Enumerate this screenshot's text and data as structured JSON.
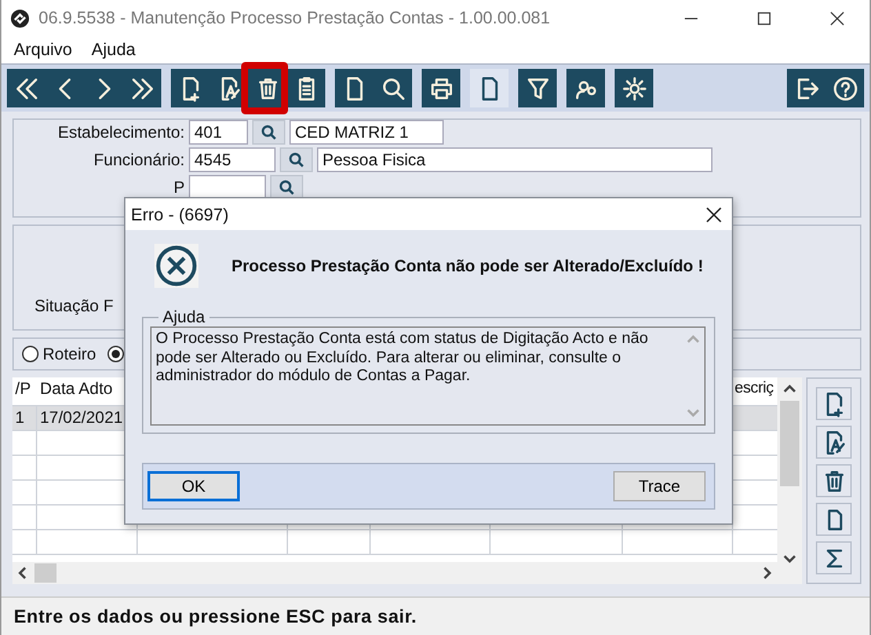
{
  "window": {
    "title": "06.9.5538 - Manutenção Processo Prestação Contas - 1.00.00.081"
  },
  "menu": [
    "Arquivo",
    "Ajuda"
  ],
  "form": {
    "fields": [
      {
        "label": "Estabelecimento:",
        "code": "401",
        "name": "CED MATRIZ 1"
      },
      {
        "label": "Funcionário:",
        "code": "4545",
        "name": "Pessoa Fisica"
      },
      {
        "label": "P"
      }
    ],
    "situacao_label": "Situação F"
  },
  "radios": [
    {
      "label": "Roteiro",
      "selected": false
    },
    {
      "selected": true
    }
  ],
  "table": {
    "columns": [
      {
        "heading": "/P"
      },
      {
        "heading": "Data Adto"
      },
      {
        "heading": "escriç"
      }
    ],
    "rows": [
      {
        "cells": [
          "1",
          "17/02/2021"
        ],
        "selected": true
      }
    ]
  },
  "dialog": {
    "title": "Erro - (6697)",
    "message": "Processo Prestação Conta não pode ser Alterado/Excluído !",
    "group_label": "Ajuda",
    "help": "O Processo Prestação Conta está com status de Digitação Acto e não pode ser Alterado ou Excluído. Para alterar ou eliminar, consulte o administrador do módulo de Contas a Pagar.",
    "buttons": [
      {
        "label": "OK",
        "focused": true
      },
      {
        "label": "Trace",
        "focused": false
      }
    ]
  },
  "status_bar": "Entre os dados ou pressione ESC para sair."
}
